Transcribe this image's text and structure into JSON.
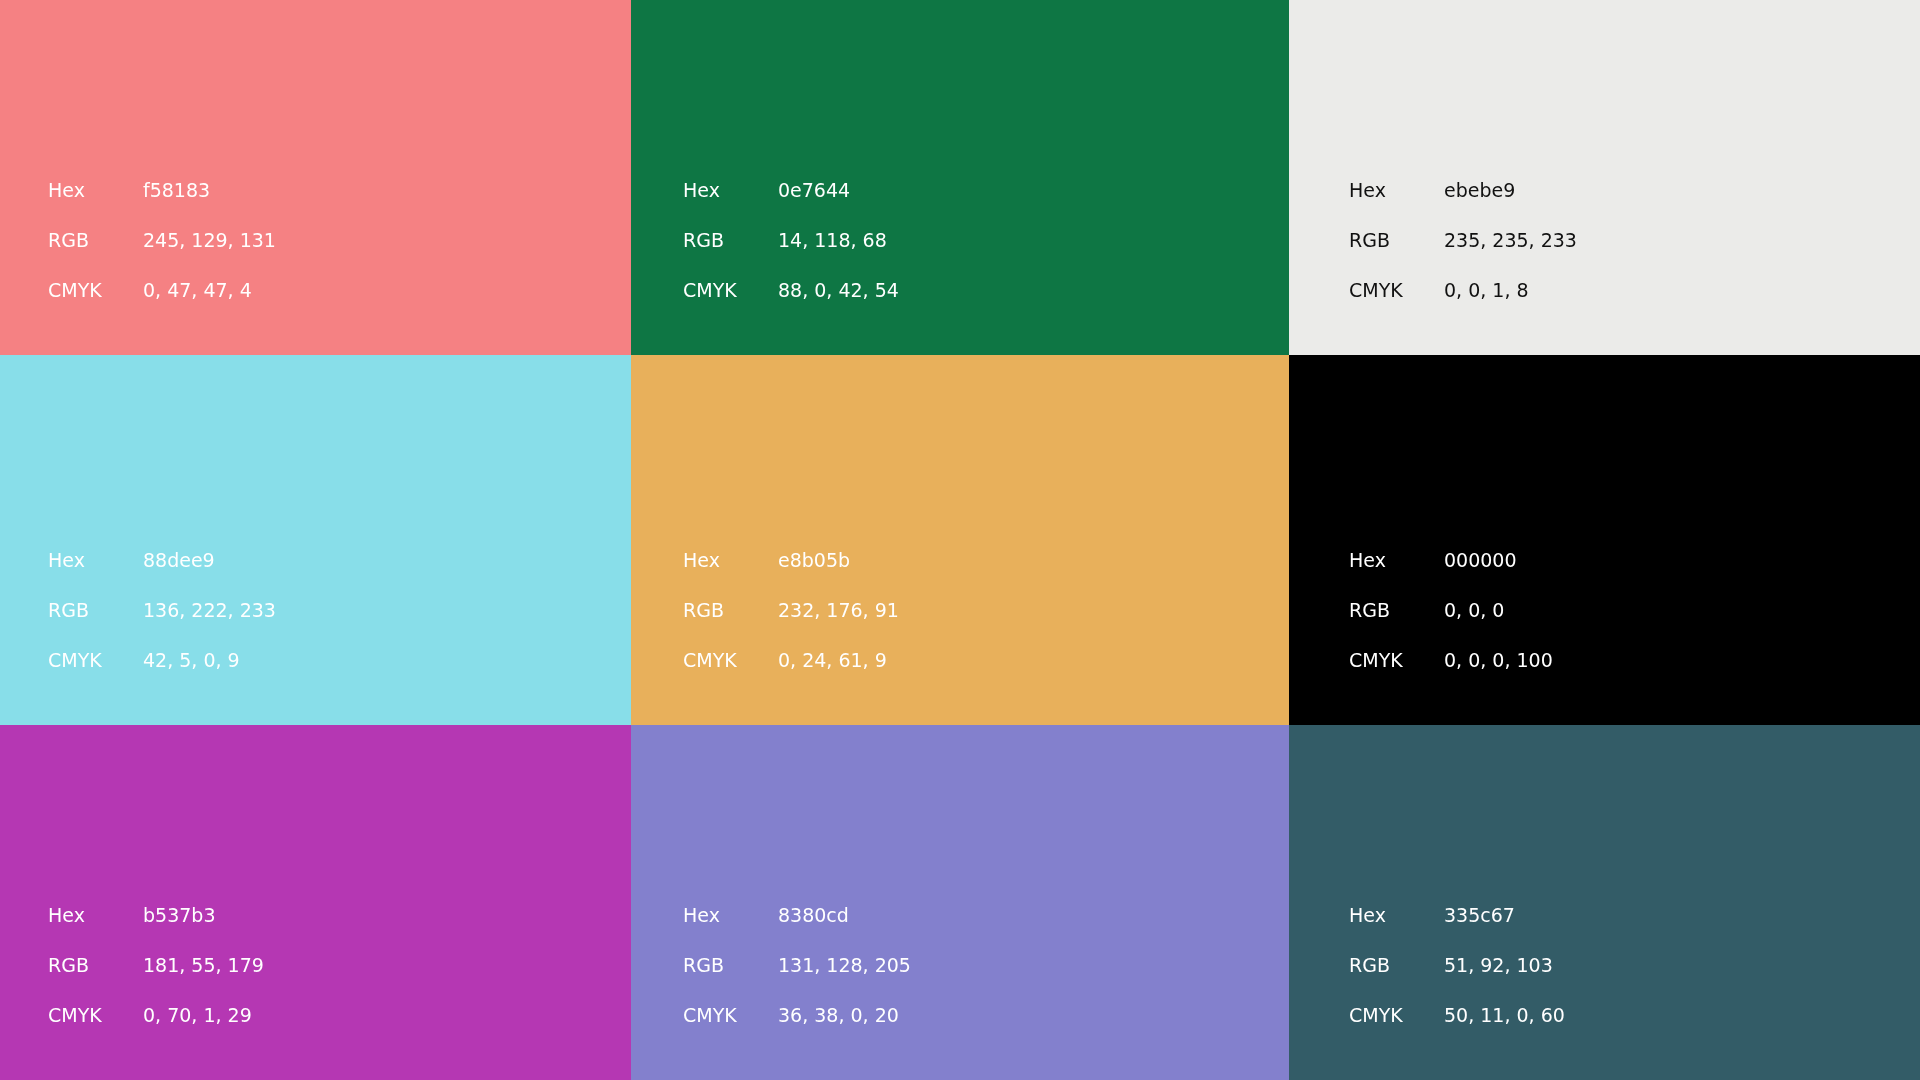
{
  "swatches": [
    {
      "color": "#f58183",
      "values": [
        {
          "label": "Hex",
          "value": "f58183"
        },
        {
          "label": "RGB",
          "value": "245, 129, 131"
        },
        {
          "label": "CMYK",
          "value": "0, 47, 47, 4"
        }
      ]
    },
    {
      "color": "#0e7644",
      "values": [
        {
          "label": "Hex",
          "value": "0e7644"
        },
        {
          "label": "RGB",
          "value": "14, 118, 68"
        },
        {
          "label": "CMYK",
          "value": "88, 0, 42, 54"
        }
      ]
    },
    {
      "color": "#ebebe9",
      "values": [
        {
          "label": "Hex",
          "value": "ebebe9"
        },
        {
          "label": "RGB",
          "value": "235, 235, 233"
        },
        {
          "label": "CMYK",
          "value": "0, 0, 1, 8"
        }
      ]
    },
    {
      "color": "#88dee9",
      "values": [
        {
          "label": "Hex",
          "value": "88dee9"
        },
        {
          "label": "RGB",
          "value": "136, 222, 233"
        },
        {
          "label": "CMYK",
          "value": "42, 5, 0, 9"
        }
      ]
    },
    {
      "color": "#e8b05b",
      "values": [
        {
          "label": "Hex",
          "value": "e8b05b"
        },
        {
          "label": "RGB",
          "value": "232, 176, 91"
        },
        {
          "label": "CMYK",
          "value": "0, 24, 61, 9"
        }
      ]
    },
    {
      "color": "#000000",
      "values": [
        {
          "label": "Hex",
          "value": "000000"
        },
        {
          "label": "RGB",
          "value": "0, 0, 0"
        },
        {
          "label": "CMYK",
          "value": "0, 0, 0, 100"
        }
      ]
    },
    {
      "color": "#b537b3",
      "values": [
        {
          "label": "Hex",
          "value": "b537b3"
        },
        {
          "label": "RGB",
          "value": "181, 55, 179"
        },
        {
          "label": "CMYK",
          "value": "0, 70, 1, 29"
        }
      ]
    },
    {
      "color": "#8380cd",
      "values": [
        {
          "label": "Hex",
          "value": "8380cd"
        },
        {
          "label": "RGB",
          "value": "131, 128, 205"
        },
        {
          "label": "CMYK",
          "value": "36, 38, 0, 20"
        }
      ]
    },
    {
      "color": "#335c67",
      "values": [
        {
          "label": "Hex",
          "value": "335c67"
        },
        {
          "label": "RGB",
          "value": "51, 92, 103"
        },
        {
          "label": "CMYK",
          "value": "50, 11, 0, 60"
        }
      ]
    }
  ]
}
